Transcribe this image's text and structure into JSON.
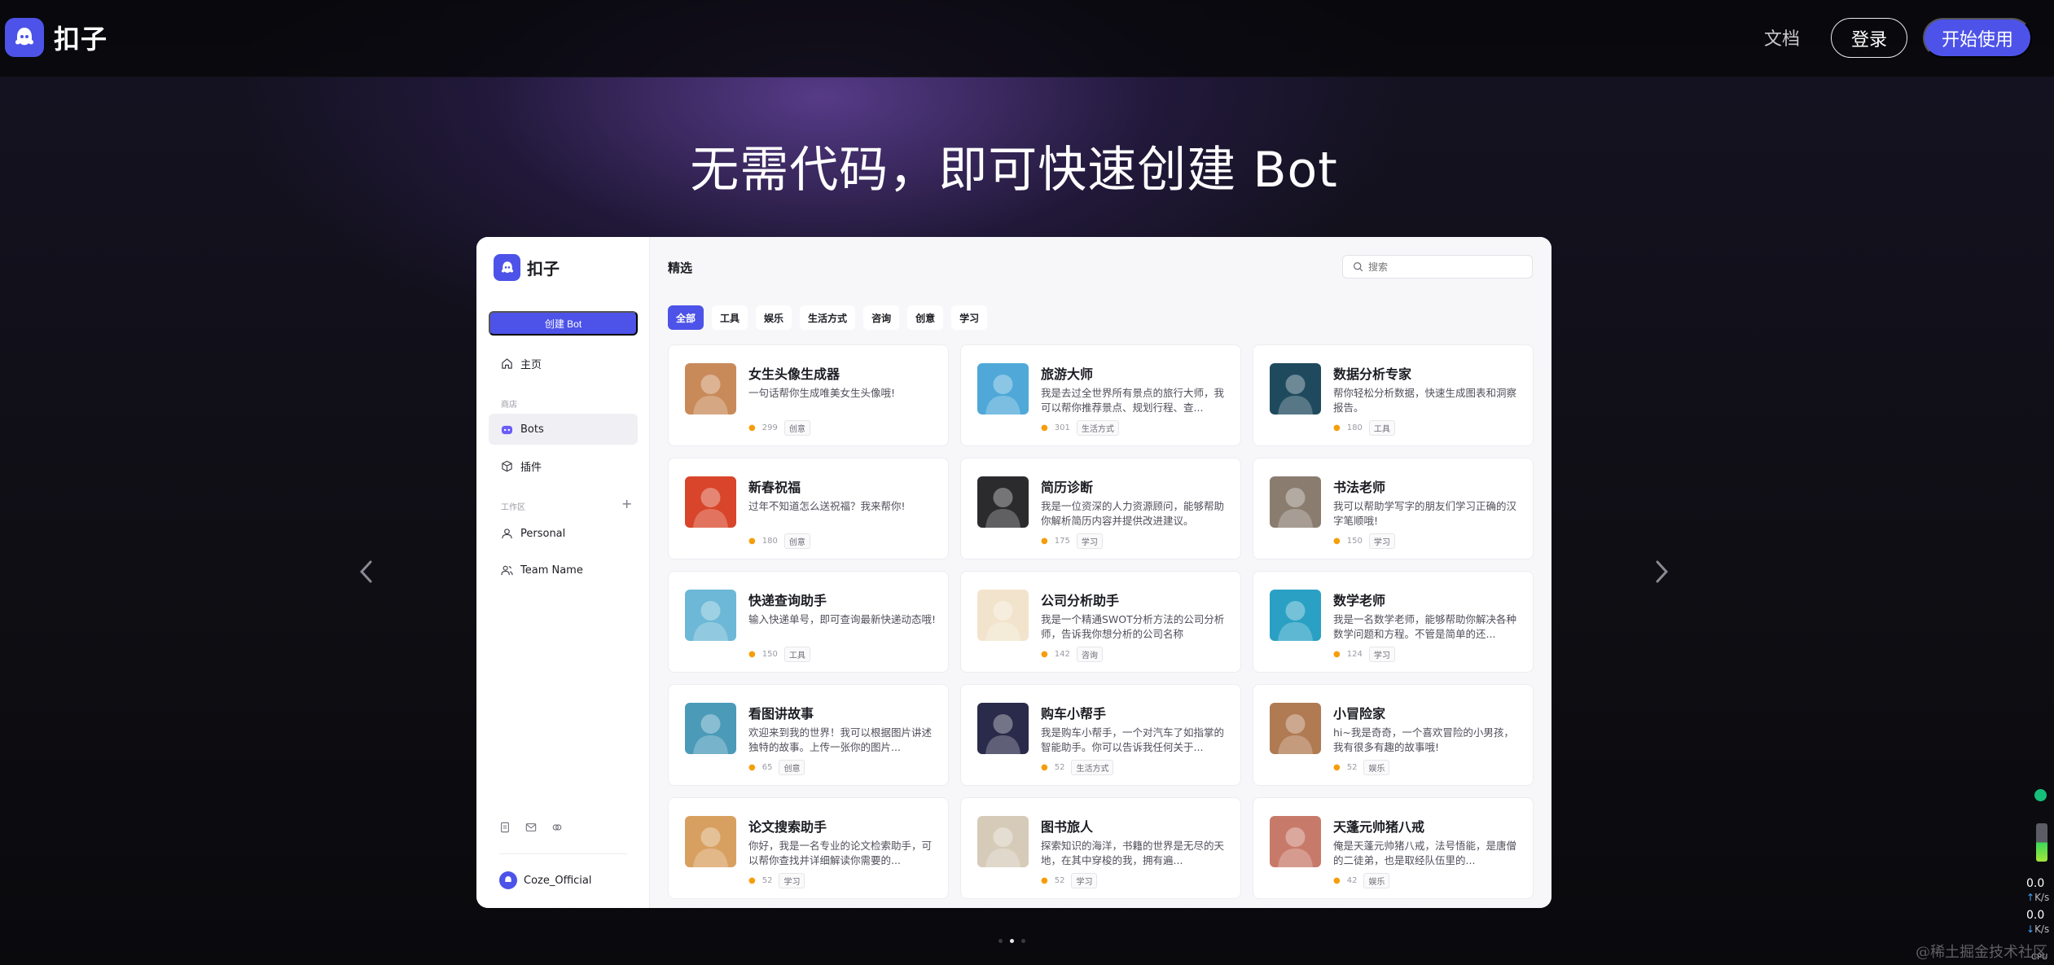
{
  "nav": {
    "brand": "扣子",
    "docs": "文档",
    "login": "登录",
    "start": "开始使用"
  },
  "hero": {
    "title": "无需代码，即可快速创建 Bot"
  },
  "preview": {
    "brand": "扣子",
    "create_button": "创建 Bot",
    "home": "主页",
    "store_section": "商店",
    "bots": "Bots",
    "plugins": "插件",
    "workspace_section": "工作区",
    "personal": "Personal",
    "team": "Team Name",
    "user": "Coze_Official",
    "main_title": "精选",
    "search_placeholder": "搜索",
    "tabs": [
      "全部",
      "工具",
      "娱乐",
      "生活方式",
      "咨询",
      "创意",
      "学习"
    ],
    "cards": [
      {
        "title": "女生头像生成器",
        "desc": "一句话帮你生成唯美女生头像哦!",
        "count": "299",
        "tag": "创意",
        "thumb": "#c98a5a"
      },
      {
        "title": "旅游大师",
        "desc": "我是去过全世界所有景点的旅行大师，我可以帮你推荐景点、规划行程、查...",
        "count": "301",
        "tag": "生活方式",
        "thumb": "#4fa8d8"
      },
      {
        "title": "数据分析专家",
        "desc": "帮你轻松分析数据，快速生成图表和洞察报告。",
        "count": "180",
        "tag": "工具",
        "thumb": "#1f4a5e"
      },
      {
        "title": "新春祝福",
        "desc": "过年不知道怎么送祝福？我来帮你!",
        "count": "180",
        "tag": "创意",
        "thumb": "#d8452a"
      },
      {
        "title": "简历诊断",
        "desc": "我是一位资深的人力资源顾问，能够帮助你解析简历内容并提供改进建议。",
        "count": "175",
        "tag": "学习",
        "thumb": "#2b2b2e"
      },
      {
        "title": "书法老师",
        "desc": "我可以帮助学写字的朋友们学习正确的汉字笔顺哦!",
        "count": "150",
        "tag": "学习",
        "thumb": "#8a7d70"
      },
      {
        "title": "快递查询助手",
        "desc": "输入快递单号，即可查询最新快递动态哦!",
        "count": "150",
        "tag": "工具",
        "thumb": "#6cb8d6"
      },
      {
        "title": "公司分析助手",
        "desc": "我是一个精通SWOT分析方法的公司分析师，告诉我你想分析的公司名称",
        "count": "142",
        "tag": "咨询",
        "thumb": "#f2e4cc"
      },
      {
        "title": "数学老师",
        "desc": "我是一名数学老师，能够帮助你解决各种数学问题和方程。不管是简单的还...",
        "count": "124",
        "tag": "学习",
        "thumb": "#2aa0c4"
      },
      {
        "title": "看图讲故事",
        "desc": "欢迎来到我的世界！我可以根据图片讲述独特的故事。上传一张你的图片...",
        "count": "65",
        "tag": "创意",
        "thumb": "#4a9ab8"
      },
      {
        "title": "购车小帮手",
        "desc": "我是购车小帮手，一个对汽车了如指掌的智能助手。你可以告诉我任何关于...",
        "count": "52",
        "tag": "生活方式",
        "thumb": "#2a2a4a"
      },
      {
        "title": "小冒险家",
        "desc": "hi~我是奇奇，一个喜欢冒险的小男孩，我有很多有趣的故事哦!",
        "count": "52",
        "tag": "娱乐",
        "thumb": "#b07a52"
      },
      {
        "title": "论文搜索助手",
        "desc": "你好，我是一名专业的论文检索助手，可以帮你查找并详细解读你需要的...",
        "count": "52",
        "tag": "学习",
        "thumb": "#d8a060"
      },
      {
        "title": "图书旅人",
        "desc": "探索知识的海洋，书籍的世界是无尽的天地，在其中穿梭的我，拥有遍...",
        "count": "52",
        "tag": "学习",
        "thumb": "#d6cbb8"
      },
      {
        "title": "天蓬元帅猪八戒",
        "desc": "俺是天蓬元帅猪八戒，法号悟能，是唐僧的二徒弟，也是取经队伍里的...",
        "count": "42",
        "tag": "娱乐",
        "thumb": "#c87a6a"
      }
    ]
  },
  "widget": {
    "up": "0.0",
    "up_unit": "K/s",
    "down": "0.0",
    "down_unit": "K/s",
    "cpu": "CPU"
  },
  "watermark": "@稀土掘金技术社区",
  "colors": {
    "accent": "#4d53e8",
    "status_ok": "#16c07a"
  }
}
